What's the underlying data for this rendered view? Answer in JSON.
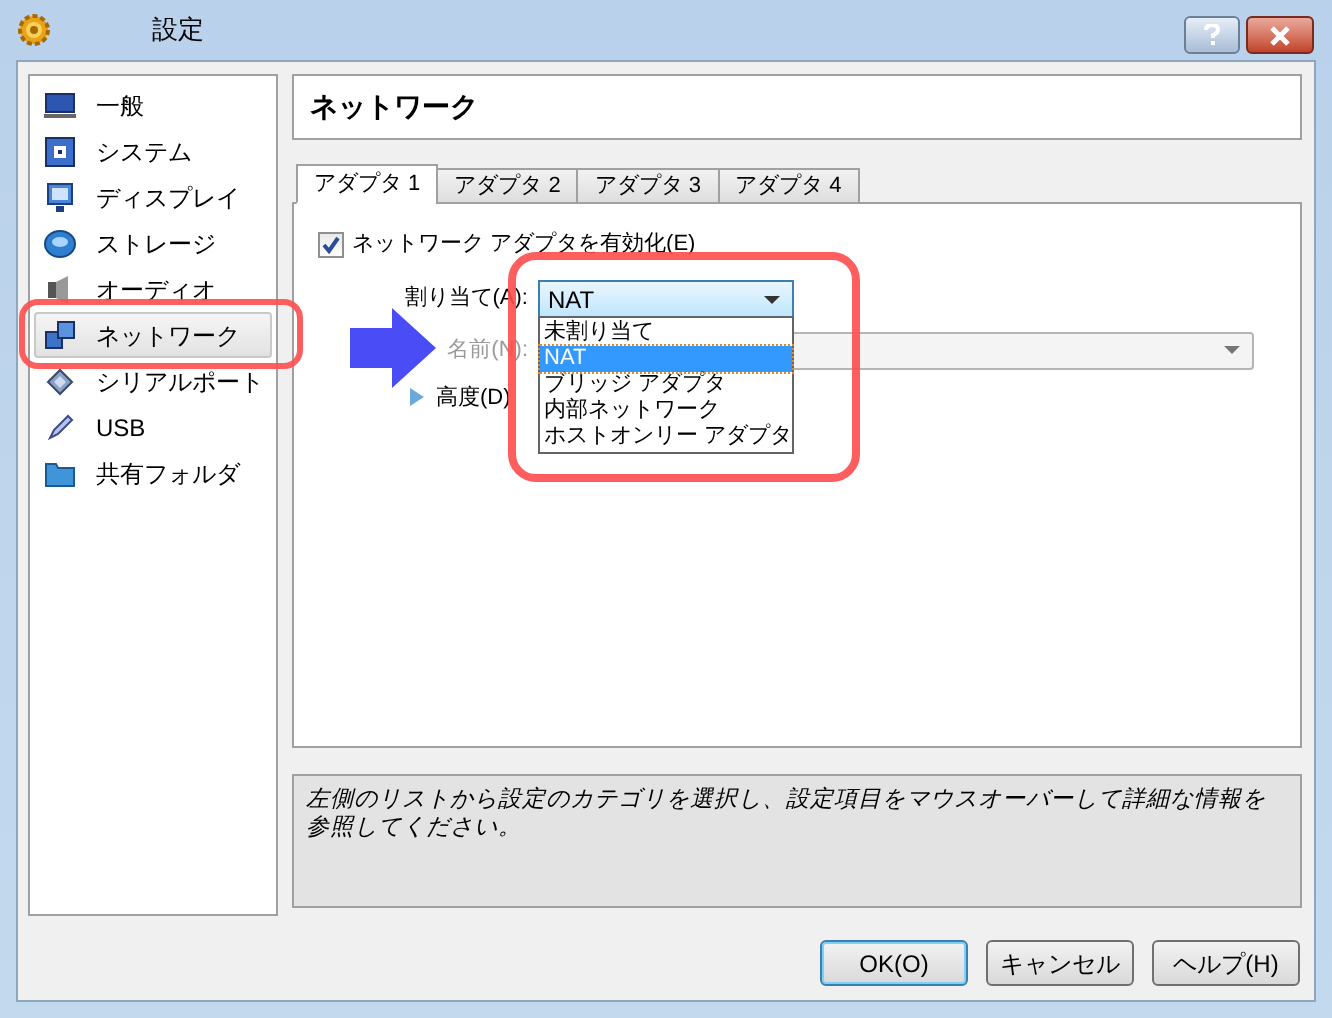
{
  "window": {
    "title": "設定"
  },
  "sidebar": {
    "items": [
      {
        "label": "一般",
        "selected": false
      },
      {
        "label": "システム",
        "selected": false
      },
      {
        "label": "ディスプレイ",
        "selected": false
      },
      {
        "label": "ストレージ",
        "selected": false
      },
      {
        "label": "オーディオ",
        "selected": false
      },
      {
        "label": "ネットワーク",
        "selected": true
      },
      {
        "label": "シリアルポート",
        "selected": false
      },
      {
        "label": "USB",
        "selected": false
      },
      {
        "label": "共有フォルダ",
        "selected": false
      }
    ]
  },
  "panel": {
    "title": "ネットワーク"
  },
  "tabs": [
    {
      "label": "アダプタ 1",
      "selected": true
    },
    {
      "label": "アダプタ 2",
      "selected": false
    },
    {
      "label": "アダプタ 3",
      "selected": false
    },
    {
      "label": "アダプタ 4",
      "selected": false
    }
  ],
  "enable_adapter": {
    "label": "ネットワーク アダプタを有効化(E)",
    "checked": true
  },
  "attached_to": {
    "label": "割り当て(A):",
    "value": "NAT",
    "expanded": true,
    "options": [
      {
        "label": "未割り当て",
        "selected": false
      },
      {
        "label": "NAT",
        "selected": true
      },
      {
        "label": "ブリッジ アダプタ",
        "selected": false
      },
      {
        "label": "内部ネットワーク",
        "selected": false
      },
      {
        "label": "ホストオンリー アダプタ",
        "selected": false
      }
    ]
  },
  "name": {
    "label": "名前(N):",
    "disabled": true
  },
  "advanced": {
    "label": "高度(D)",
    "expanded": false
  },
  "info": "左側のリストから設定のカテゴリを選択し、設定項目をマウスオーバーして詳細な情報を参照してください。",
  "buttons": [
    {
      "label": "OK(O)",
      "default": true
    },
    {
      "label": "キャンセル",
      "default": false
    },
    {
      "label": "ヘルプ(H)",
      "default": false
    }
  ]
}
